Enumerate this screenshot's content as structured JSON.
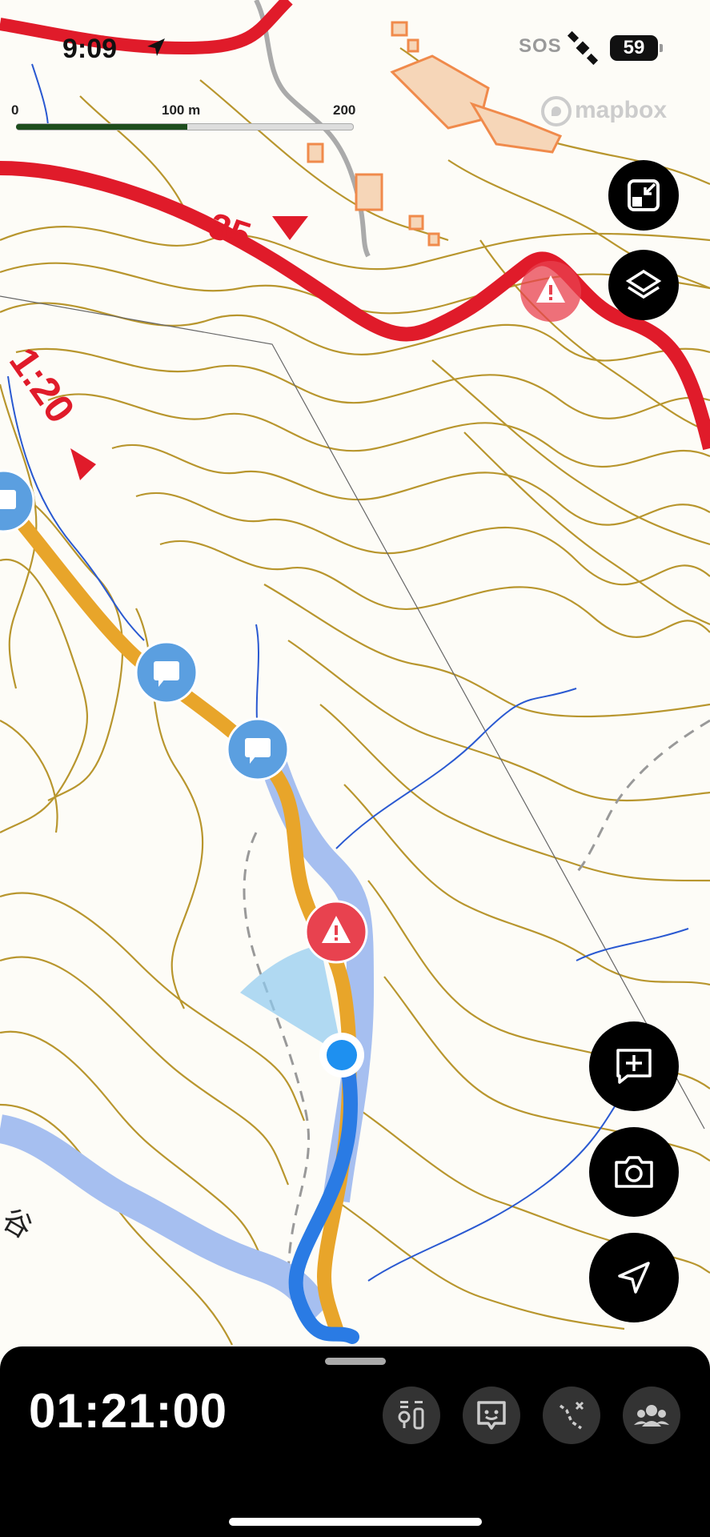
{
  "status_bar": {
    "time": "9:09",
    "sos": "SOS",
    "battery": "59"
  },
  "scale": {
    "labels": [
      "0",
      "100 m",
      "200 m"
    ]
  },
  "attribution": {
    "brand": "mapbox"
  },
  "map_labels": {
    "road_number": "35",
    "grade": "1:20",
    "kanji": "谷"
  },
  "map_buttons": [
    "collapse-view",
    "layers",
    "add-note",
    "camera",
    "locate"
  ],
  "bottom_panel": {
    "elapsed": "01:21:00",
    "tools": [
      "waypoints",
      "feedback",
      "route-edit",
      "group"
    ]
  },
  "colors": {
    "road": "#e01b2a",
    "track": "#e8a52a",
    "recorded": "#2a7be4",
    "contour": "#b8962e",
    "warning": "#e8424f",
    "note": "#5b9fe0"
  }
}
